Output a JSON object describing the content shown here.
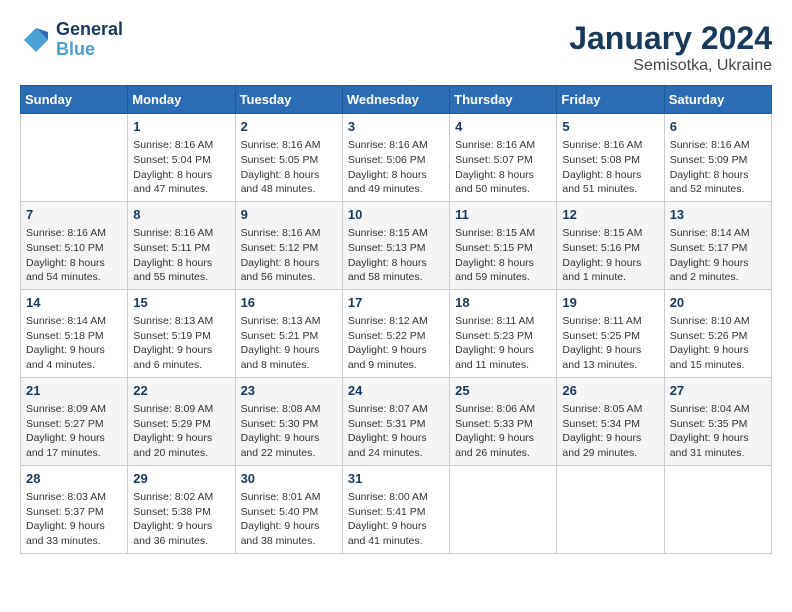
{
  "logo": {
    "line1": "General",
    "line2": "Blue"
  },
  "title": "January 2024",
  "subtitle": "Semisotka, Ukraine",
  "days_header": [
    "Sunday",
    "Monday",
    "Tuesday",
    "Wednesday",
    "Thursday",
    "Friday",
    "Saturday"
  ],
  "weeks": [
    [
      {
        "day": "",
        "info": ""
      },
      {
        "day": "1",
        "info": "Sunrise: 8:16 AM\nSunset: 5:04 PM\nDaylight: 8 hours\nand 47 minutes."
      },
      {
        "day": "2",
        "info": "Sunrise: 8:16 AM\nSunset: 5:05 PM\nDaylight: 8 hours\nand 48 minutes."
      },
      {
        "day": "3",
        "info": "Sunrise: 8:16 AM\nSunset: 5:06 PM\nDaylight: 8 hours\nand 49 minutes."
      },
      {
        "day": "4",
        "info": "Sunrise: 8:16 AM\nSunset: 5:07 PM\nDaylight: 8 hours\nand 50 minutes."
      },
      {
        "day": "5",
        "info": "Sunrise: 8:16 AM\nSunset: 5:08 PM\nDaylight: 8 hours\nand 51 minutes."
      },
      {
        "day": "6",
        "info": "Sunrise: 8:16 AM\nSunset: 5:09 PM\nDaylight: 8 hours\nand 52 minutes."
      }
    ],
    [
      {
        "day": "7",
        "info": "Sunrise: 8:16 AM\nSunset: 5:10 PM\nDaylight: 8 hours\nand 54 minutes."
      },
      {
        "day": "8",
        "info": "Sunrise: 8:16 AM\nSunset: 5:11 PM\nDaylight: 8 hours\nand 55 minutes."
      },
      {
        "day": "9",
        "info": "Sunrise: 8:16 AM\nSunset: 5:12 PM\nDaylight: 8 hours\nand 56 minutes."
      },
      {
        "day": "10",
        "info": "Sunrise: 8:15 AM\nSunset: 5:13 PM\nDaylight: 8 hours\nand 58 minutes."
      },
      {
        "day": "11",
        "info": "Sunrise: 8:15 AM\nSunset: 5:15 PM\nDaylight: 8 hours\nand 59 minutes."
      },
      {
        "day": "12",
        "info": "Sunrise: 8:15 AM\nSunset: 5:16 PM\nDaylight: 9 hours\nand 1 minute."
      },
      {
        "day": "13",
        "info": "Sunrise: 8:14 AM\nSunset: 5:17 PM\nDaylight: 9 hours\nand 2 minutes."
      }
    ],
    [
      {
        "day": "14",
        "info": "Sunrise: 8:14 AM\nSunset: 5:18 PM\nDaylight: 9 hours\nand 4 minutes."
      },
      {
        "day": "15",
        "info": "Sunrise: 8:13 AM\nSunset: 5:19 PM\nDaylight: 9 hours\nand 6 minutes."
      },
      {
        "day": "16",
        "info": "Sunrise: 8:13 AM\nSunset: 5:21 PM\nDaylight: 9 hours\nand 8 minutes."
      },
      {
        "day": "17",
        "info": "Sunrise: 8:12 AM\nSunset: 5:22 PM\nDaylight: 9 hours\nand 9 minutes."
      },
      {
        "day": "18",
        "info": "Sunrise: 8:11 AM\nSunset: 5:23 PM\nDaylight: 9 hours\nand 11 minutes."
      },
      {
        "day": "19",
        "info": "Sunrise: 8:11 AM\nSunset: 5:25 PM\nDaylight: 9 hours\nand 13 minutes."
      },
      {
        "day": "20",
        "info": "Sunrise: 8:10 AM\nSunset: 5:26 PM\nDaylight: 9 hours\nand 15 minutes."
      }
    ],
    [
      {
        "day": "21",
        "info": "Sunrise: 8:09 AM\nSunset: 5:27 PM\nDaylight: 9 hours\nand 17 minutes."
      },
      {
        "day": "22",
        "info": "Sunrise: 8:09 AM\nSunset: 5:29 PM\nDaylight: 9 hours\nand 20 minutes."
      },
      {
        "day": "23",
        "info": "Sunrise: 8:08 AM\nSunset: 5:30 PM\nDaylight: 9 hours\nand 22 minutes."
      },
      {
        "day": "24",
        "info": "Sunrise: 8:07 AM\nSunset: 5:31 PM\nDaylight: 9 hours\nand 24 minutes."
      },
      {
        "day": "25",
        "info": "Sunrise: 8:06 AM\nSunset: 5:33 PM\nDaylight: 9 hours\nand 26 minutes."
      },
      {
        "day": "26",
        "info": "Sunrise: 8:05 AM\nSunset: 5:34 PM\nDaylight: 9 hours\nand 29 minutes."
      },
      {
        "day": "27",
        "info": "Sunrise: 8:04 AM\nSunset: 5:35 PM\nDaylight: 9 hours\nand 31 minutes."
      }
    ],
    [
      {
        "day": "28",
        "info": "Sunrise: 8:03 AM\nSunset: 5:37 PM\nDaylight: 9 hours\nand 33 minutes."
      },
      {
        "day": "29",
        "info": "Sunrise: 8:02 AM\nSunset: 5:38 PM\nDaylight: 9 hours\nand 36 minutes."
      },
      {
        "day": "30",
        "info": "Sunrise: 8:01 AM\nSunset: 5:40 PM\nDaylight: 9 hours\nand 38 minutes."
      },
      {
        "day": "31",
        "info": "Sunrise: 8:00 AM\nSunset: 5:41 PM\nDaylight: 9 hours\nand 41 minutes."
      },
      {
        "day": "",
        "info": ""
      },
      {
        "day": "",
        "info": ""
      },
      {
        "day": "",
        "info": ""
      }
    ]
  ]
}
